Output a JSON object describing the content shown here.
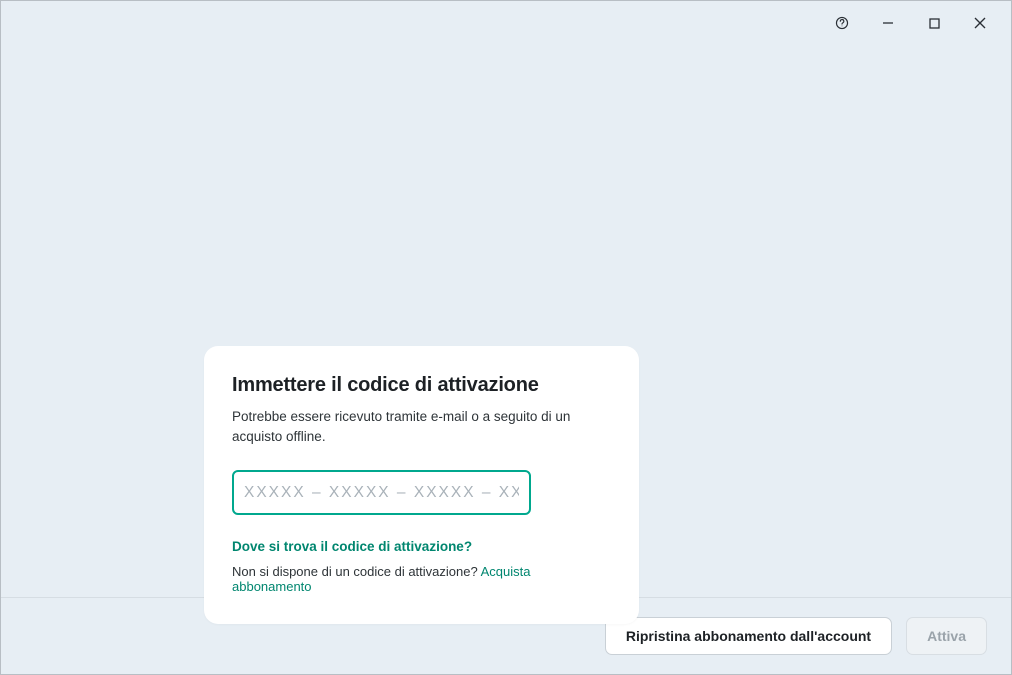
{
  "titlebar": {
    "help_icon": "help-icon",
    "minimize_icon": "minimize-icon",
    "maximize_icon": "maximize-icon",
    "close_icon": "close-icon"
  },
  "card": {
    "title": "Immettere il codice di attivazione",
    "subtitle": "Potrebbe essere ricevuto tramite e-mail o a seguito di un acquisto offline.",
    "input_placeholder": "ХХХХХ – ХХХХХ – ХХХХХ – ХХХХХ",
    "input_value": "",
    "help_link": "Dove si trova il codice di attivazione?",
    "purchase_prompt": "Non si dispone di un codice di attivazione? ",
    "purchase_link": "Acquista abbonamento"
  },
  "footer": {
    "restore_label": "Ripristina abbonamento dall'account",
    "activate_label": "Attiva"
  }
}
